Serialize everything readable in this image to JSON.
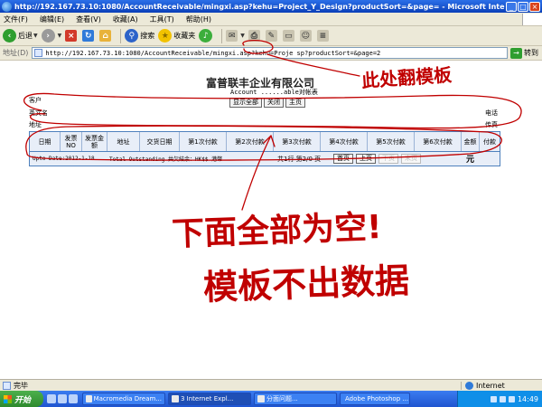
{
  "window": {
    "title": "http://192.167.73.10:1080/AccountReceivable/mingxi.asp?kehu=Project_Y_Design?productSort=&page= - Microsoft Inter...",
    "minimize": "_",
    "maximize": "□",
    "close": "×"
  },
  "menu": [
    "文件(F)",
    "编辑(E)",
    "查看(V)",
    "收藏(A)",
    "工具(T)",
    "帮助(H)"
  ],
  "toolbar": {
    "back_label": "后退",
    "search_label": "搜索",
    "favorites_label": "收藏夹"
  },
  "address": {
    "label": "地址(D)",
    "url": "http://192.167.73.10:1080/AccountReceivable/mingxi.asp?kehu=Proje          sp?productSort=&page=2",
    "go_label": "转到"
  },
  "page": {
    "company_title": "富普联丰企业有限公司",
    "subtitle": "Account ......able对帐表",
    "buttons": [
      "显示全部",
      "关闭",
      "主页"
    ],
    "label_customer": "客户",
    "label_en_name": "英文名",
    "label_address": "地址",
    "label_phone": "电话",
    "label_fax": "传真"
  },
  "table": {
    "columns": [
      "日期",
      "发票NO",
      "发票金额",
      "地址",
      "交货日期",
      "第1次付款",
      "第2次付款",
      "第3次付款",
      "第4次付款",
      "第5次付款",
      "第6次付款",
      "金额",
      "付款"
    ],
    "footer": {
      "upto": "Upto Date:2012-1-18",
      "outstanding": "Total Outstanding 共欠結余：HK$$ 港幣",
      "page_info": "共1行 第2/0 页",
      "nav_buttons": [
        "首页",
        "上页",
        "下页",
        "末页"
      ],
      "glyph": "元"
    }
  },
  "annotations": {
    "top": "此处翻模板",
    "middle": "下面全部为空!",
    "bottom": "模板不出数据"
  },
  "status": {
    "text": "完毕",
    "zone": "Internet"
  },
  "taskbar": {
    "start": "开始",
    "tasks": [
      "Macromedia Dream...",
      "3 Internet Expl...",
      "分面问题...",
      "Adobe Photoshop ..."
    ],
    "clock": "14:49"
  }
}
